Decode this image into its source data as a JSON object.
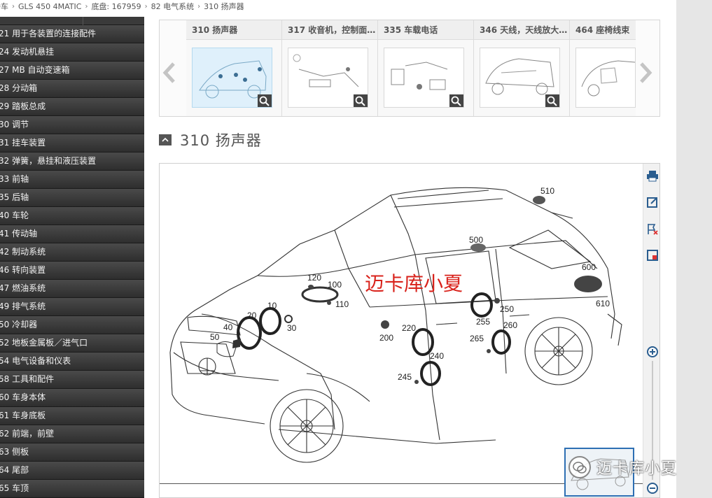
{
  "breadcrumb": [
    "轿车",
    "GLS 450 4MATIC",
    "底盘: 167959",
    "82 电气系统",
    "310 扬声器"
  ],
  "sidebar": {
    "items": [
      "21 用于各装置的连接配件",
      "24 发动机悬挂",
      "27 MB 自动变速箱",
      "28 分动箱",
      "29 踏板总成",
      "30 调节",
      "31 挂车装置",
      "32 弹簧，悬挂和液压装置",
      "33 前轴",
      "35 后轴",
      "40 车轮",
      "41 传动轴",
      "42 制动系统",
      "46 转向装置",
      "47 燃油系统",
      "49 排气系统",
      "50 冷却器",
      "52 地板金属板／进气口",
      "54 电气设备和仪表",
      "58 工具和配件",
      "60 车身本体",
      "61 车身底板",
      "62 前端，前壁",
      "63 侧板",
      "64 尾部",
      "65 车顶"
    ]
  },
  "carousel": {
    "prev_icon": "chevron-left-icon",
    "next_icon": "chevron-right-icon",
    "thumbnails": [
      {
        "title": "310 扬声器",
        "selected": true
      },
      {
        "title": "317 收音机，控制面…",
        "selected": false
      },
      {
        "title": "335 车载电话",
        "selected": false
      },
      {
        "title": "346 天线，天线放大…",
        "selected": false
      },
      {
        "title": "464 座椅线束",
        "selected": false
      }
    ]
  },
  "section": {
    "title": "310 扬声器",
    "toggle_icon": "collapse-icon"
  },
  "diagram": {
    "callouts": [
      "510",
      "500",
      "600",
      "610",
      "120",
      "100",
      "110",
      "10",
      "20",
      "30",
      "40",
      "50",
      "200",
      "220",
      "240",
      "245",
      "250",
      "255",
      "260",
      "265"
    ]
  },
  "watermark": {
    "text": "迈卡库小夏"
  },
  "toolbar": {
    "icons": [
      "print-icon",
      "open-window-icon",
      "flag-remove-icon",
      "export-icon",
      "zoom-in-icon",
      "zoom-out-icon"
    ]
  },
  "colors": {
    "sidebar_bg": "#2c2c2c",
    "watermark": "#d9231c",
    "minimap_border": "#2d6fb3"
  }
}
